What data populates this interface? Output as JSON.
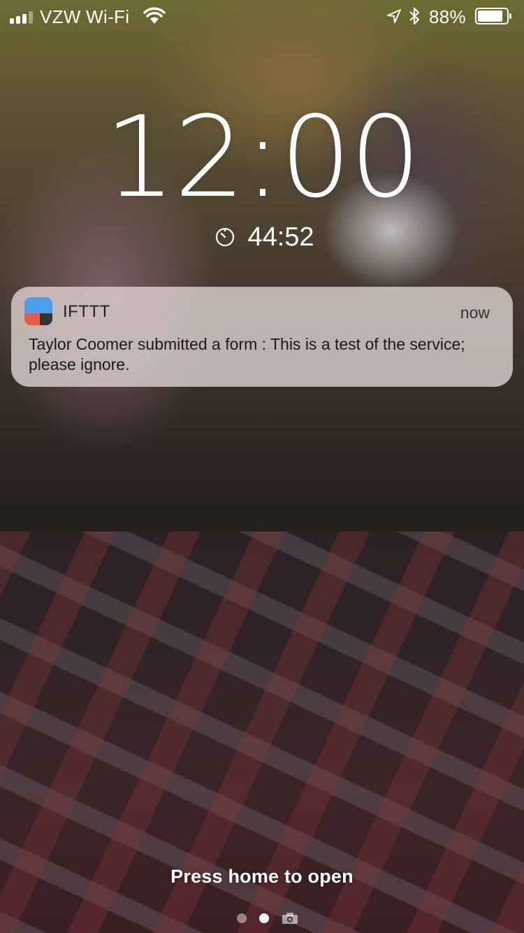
{
  "status_bar": {
    "carrier": "VZW Wi-Fi",
    "battery_percent": "88%",
    "battery_level": 0.88,
    "signal_bars": 3,
    "signal_bars_total": 4,
    "icons": [
      "signal-icon",
      "wifi-icon",
      "location-icon",
      "bluetooth-icon",
      "battery-icon"
    ]
  },
  "lock_screen": {
    "time": "12:00",
    "timer": "44:52",
    "timer_icon": "timer-icon"
  },
  "notification": {
    "app_name": "IFTTT",
    "time": "now",
    "body": "Taylor Coomer submitted a form : This is a test of the service; please ignore.",
    "app_icon_colors": {
      "top": "#4aa0ee",
      "bottom_left": "#e65a4a",
      "bottom_right": "#333333"
    }
  },
  "bottom": {
    "hint": "Press home to open",
    "pages": [
      "page-dot",
      "page-dot-active",
      "camera-icon"
    ]
  }
}
